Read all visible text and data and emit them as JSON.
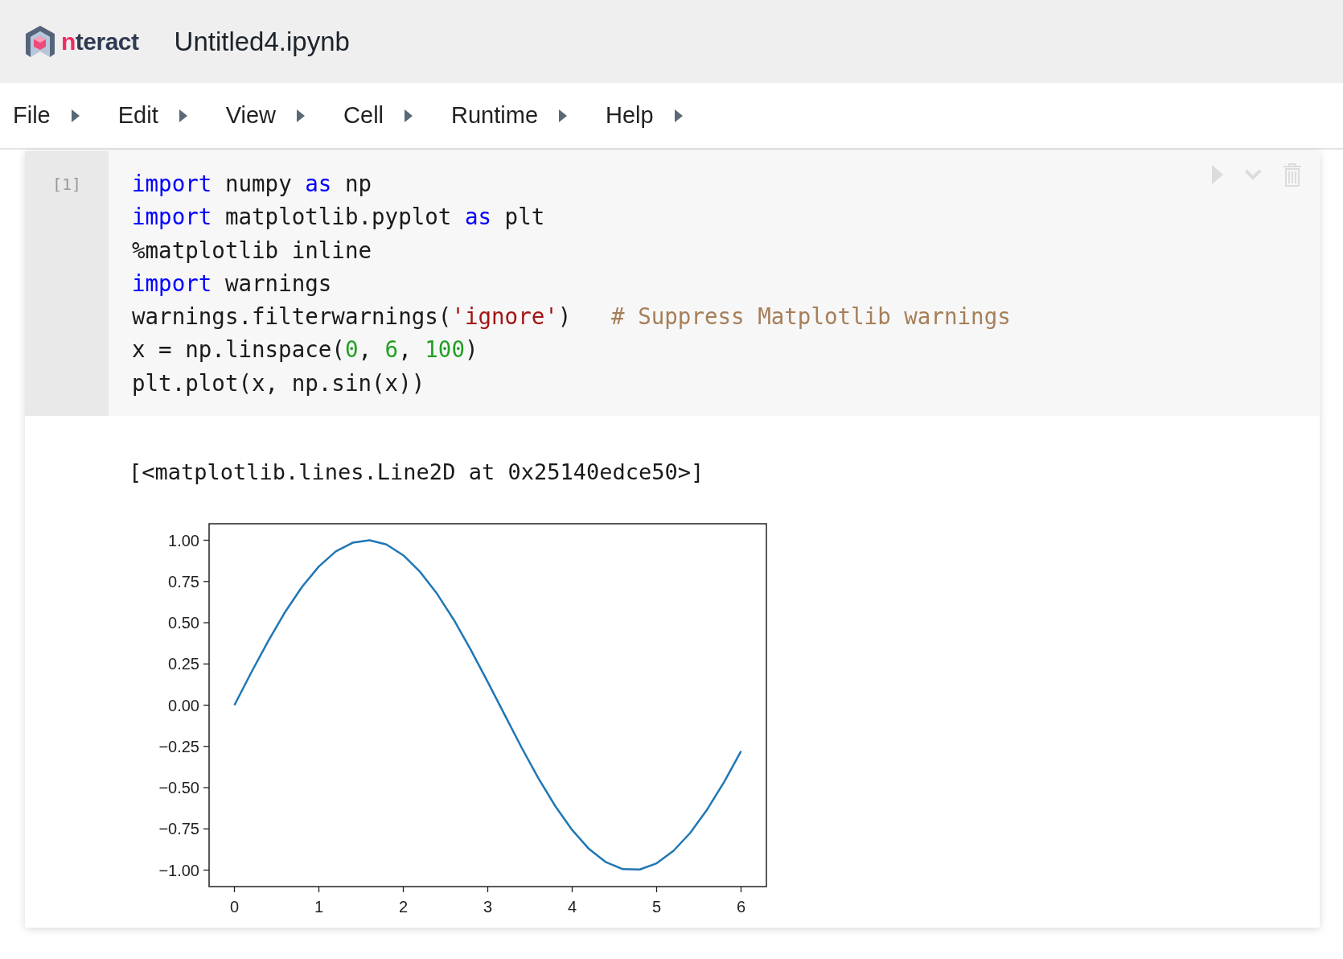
{
  "header": {
    "logo": {
      "accent": "n",
      "rest": "teract"
    },
    "title": "Untitled4.ipynb"
  },
  "menu": [
    {
      "label": "File"
    },
    {
      "label": "Edit"
    },
    {
      "label": "View"
    },
    {
      "label": "Cell"
    },
    {
      "label": "Runtime"
    },
    {
      "label": "Help"
    }
  ],
  "cell": {
    "prompt": "[1]",
    "code": [
      [
        {
          "kind": "keyword",
          "text": "import"
        },
        {
          "kind": "plain",
          "text": " numpy "
        },
        {
          "kind": "keyword",
          "text": "as"
        },
        {
          "kind": "plain",
          "text": " np"
        }
      ],
      [
        {
          "kind": "keyword",
          "text": "import"
        },
        {
          "kind": "plain",
          "text": " matplotlib.pyplot "
        },
        {
          "kind": "keyword",
          "text": "as"
        },
        {
          "kind": "plain",
          "text": " plt"
        }
      ],
      [
        {
          "kind": "plain",
          "text": "%matplotlib inline"
        }
      ],
      [
        {
          "kind": "keyword",
          "text": "import"
        },
        {
          "kind": "plain",
          "text": " warnings"
        }
      ],
      [
        {
          "kind": "plain",
          "text": "warnings.filterwarnings("
        },
        {
          "kind": "string",
          "text": "'ignore'"
        },
        {
          "kind": "plain",
          "text": ")   "
        },
        {
          "kind": "comment",
          "text": "# Suppress Matplotlib warnings"
        }
      ],
      [
        {
          "kind": "plain",
          "text": "x = np.linspace("
        },
        {
          "kind": "number",
          "text": "0"
        },
        {
          "kind": "plain",
          "text": ", "
        },
        {
          "kind": "number",
          "text": "6"
        },
        {
          "kind": "plain",
          "text": ", "
        },
        {
          "kind": "number",
          "text": "100"
        },
        {
          "kind": "plain",
          "text": ")"
        }
      ],
      [
        {
          "kind": "plain",
          "text": "plt.plot(x, np.sin(x))"
        }
      ]
    ],
    "output_text": "[<matplotlib.lines.Line2D at 0x25140edce50>]",
    "chart_data": {
      "type": "line",
      "x": [
        0,
        0.2,
        0.4,
        0.6,
        0.8,
        1,
        1.2,
        1.4,
        1.6,
        1.8,
        2,
        2.2,
        2.4,
        2.6,
        2.8,
        3,
        3.2,
        3.4,
        3.6,
        3.8,
        4,
        4.2,
        4.4,
        4.6,
        4.8,
        5,
        5.2,
        5.4,
        5.6,
        5.8,
        6
      ],
      "series": [
        {
          "color": "#1f77b4",
          "values": [
            0,
            0.199,
            0.389,
            0.565,
            0.717,
            0.841,
            0.932,
            0.985,
            1,
            0.974,
            0.909,
            0.808,
            0.675,
            0.516,
            0.335,
            0.141,
            -0.058,
            -0.256,
            -0.443,
            -0.612,
            -0.757,
            -0.872,
            -0.952,
            -0.994,
            -0.996,
            -0.959,
            -0.883,
            -0.773,
            -0.631,
            -0.465,
            -0.279
          ]
        }
      ],
      "xlim": [
        -0.3,
        6.3
      ],
      "ylim": [
        -1.1,
        1.1
      ],
      "xticks": [
        0,
        1,
        2,
        3,
        4,
        5,
        6
      ],
      "yticks": [
        {
          "value": 1,
          "label": "1.00"
        },
        {
          "value": 0.75,
          "label": "0.75"
        },
        {
          "value": 0.5,
          "label": "0.50"
        },
        {
          "value": 0.25,
          "label": "0.25"
        },
        {
          "value": 0,
          "label": "0.00"
        },
        {
          "value": -0.25,
          "label": "−0.25"
        },
        {
          "value": -0.5,
          "label": "−0.50"
        },
        {
          "value": -0.75,
          "label": "−0.75"
        },
        {
          "value": -1,
          "label": "−1.00"
        }
      ]
    }
  }
}
